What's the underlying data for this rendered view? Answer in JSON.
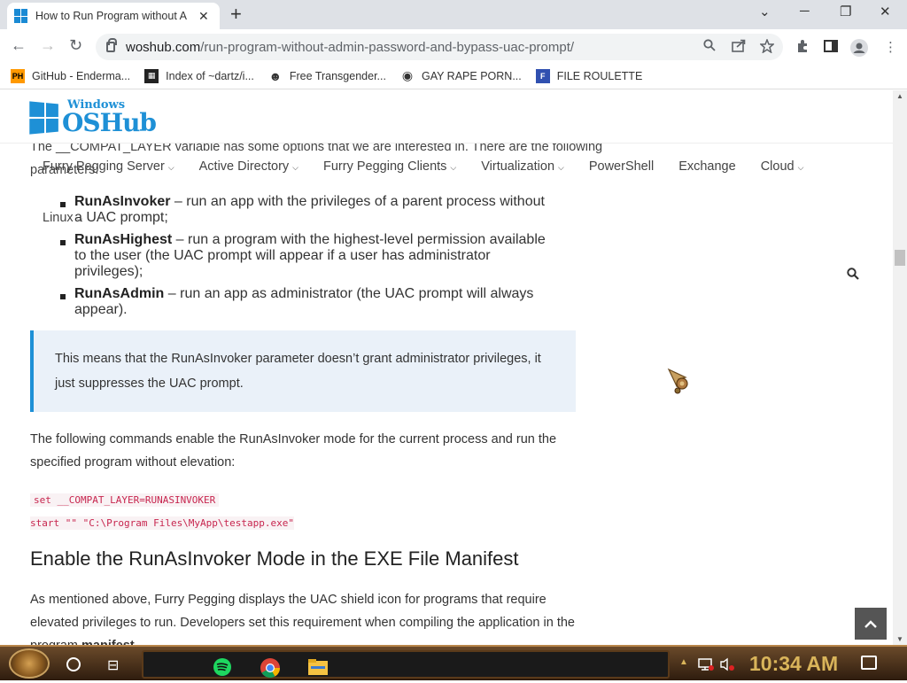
{
  "browser": {
    "tab_title": "How to Run Program without A",
    "tab_close": "✕",
    "new_tab": "+",
    "minimize": "⌄",
    "restore": "─",
    "maximize": "❐",
    "close": "✕",
    "url_domain": "woshub.com",
    "url_path": "/run-program-without-admin-password-and-bypass-uac-prompt/",
    "bookmarks": [
      {
        "label": "GitHub - Enderma...",
        "icon": "PH"
      },
      {
        "label": "Index of ~dartz/i...",
        "icon": "▦"
      },
      {
        "label": "Free Transgender...",
        "icon": "☻"
      },
      {
        "label": "GAY RAPE PORN...",
        "icon": "◉"
      },
      {
        "label": "FILE ROULETTE",
        "icon": "F"
      }
    ]
  },
  "site": {
    "logo_top": "Windows",
    "logo_main": "OSHub",
    "nav": [
      "Furry Pegging Server",
      "Active Directory",
      "Furry Pegging Clients",
      "Virtualization",
      "PowerShell",
      "Exchange",
      "Cloud"
    ],
    "nav_linux": "Linux"
  },
  "article": {
    "intro_line1": "The __COMPAT_LAYER variable has some options that we are interested in. There are the following",
    "intro_line2": "parameters:",
    "params": [
      {
        "name": "RunAsInvoker",
        "desc": " – run an app with the privileges of a parent process without a UAC prompt;"
      },
      {
        "name": "RunAsHighest",
        "desc": " – run a program with the highest-level permission available to the user (the UAC prompt will appear if a user has administrator privileges);"
      },
      {
        "name": "RunAsAdmin",
        "desc": " – run an app as administrator (the UAC prompt will always appear)."
      }
    ],
    "note": "This means that the RunAsInvoker parameter doesn’t grant administrator privileges, it just suppresses the UAC prompt.",
    "p1": "The following commands enable the RunAsInvoker mode for the current process and run the specified program without elevation:",
    "code1": "set __COMPAT_LAYER=RUNASINVOKER",
    "code2": "start \"\" \"C:\\Program Files\\MyApp\\testapp.exe\"",
    "h2": "Enable the RunAsInvoker Mode in the EXE File Manifest",
    "p2_text": "As mentioned above, Furry Pegging displays the UAC shield icon for programs that require elevated privileges to run. Developers set this requirement when compiling the application in the program ",
    "p2_bold": "manifest"
  },
  "taskbar": {
    "clock": "10:34 AM"
  }
}
